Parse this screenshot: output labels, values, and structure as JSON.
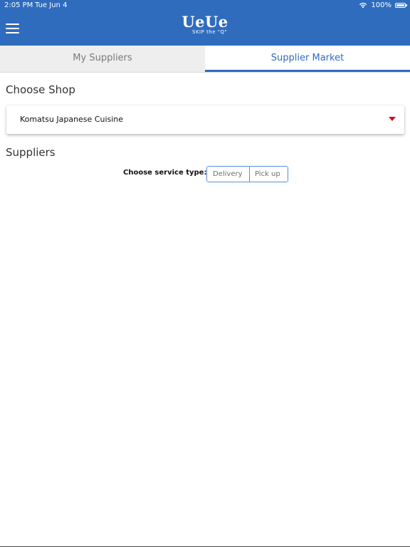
{
  "status_bar": {
    "time": "2:05 PM",
    "date": "Tue Jun 4",
    "battery": "100%",
    "icons": [
      "wifi-icon",
      "battery-icon"
    ]
  },
  "header": {
    "logo_main": "UeUe",
    "logo_tagline": "SKIP the \"Q\"",
    "menu_icon": "hamburger-menu-icon",
    "color": "#2f6cbe"
  },
  "tabs": [
    {
      "label": "My Suppliers",
      "active": false
    },
    {
      "label": "Supplier Market",
      "active": true
    }
  ],
  "shop_section": {
    "title": "Choose Shop",
    "selected_shop": "Komatsu Japanese Cuisine",
    "dropdown_icon": "triangle-down-icon",
    "arrow_color": "#d0101c"
  },
  "suppliers_section": {
    "title": "Suppliers",
    "service_type_label": "Choose service type:",
    "service_options": [
      "Delivery",
      "Pick up"
    ]
  }
}
